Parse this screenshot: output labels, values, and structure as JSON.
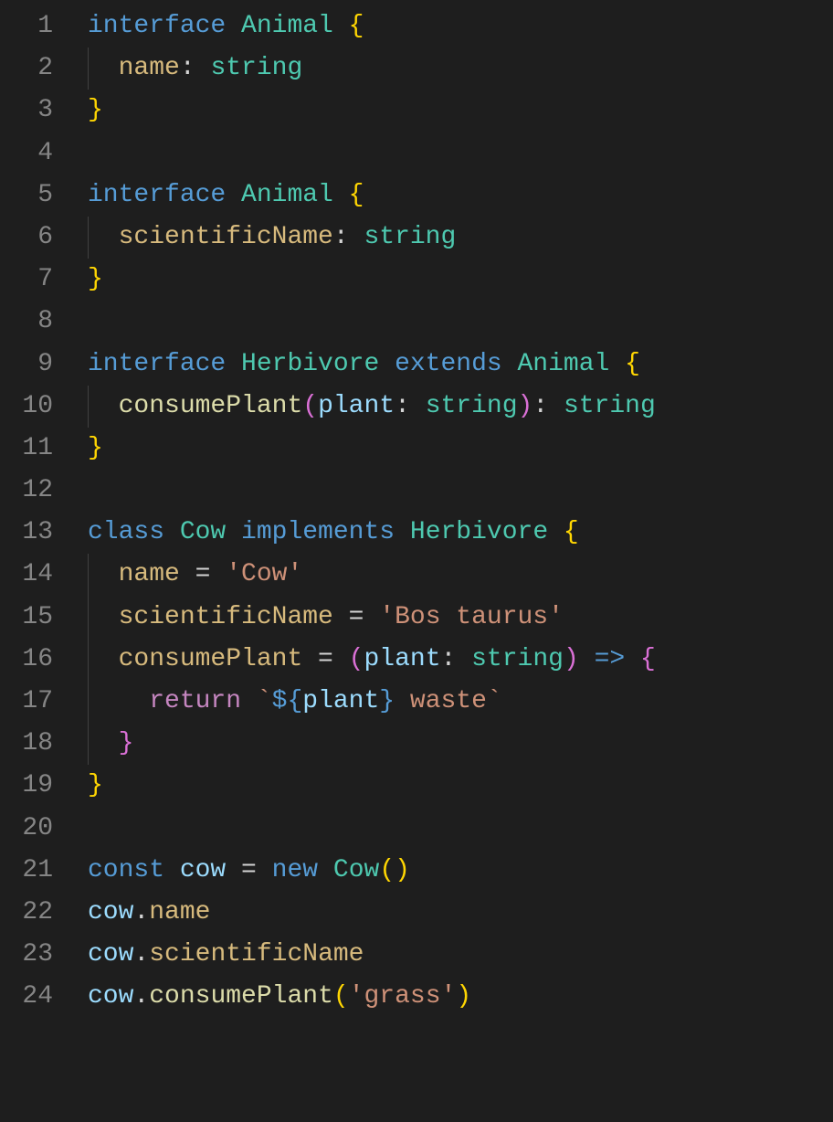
{
  "colors": {
    "background": "#1e1e1e",
    "gutter": "#858585",
    "keyword": "#569cd6",
    "type": "#4ec9b0",
    "property": "#d7ba7d",
    "variable": "#9cdcfe",
    "function": "#dcdcaa",
    "string": "#ce9178",
    "braceYellow": "#ffd602",
    "braceMagenta": "#da70d6",
    "control": "#c586c0"
  },
  "lineNumbers": [
    "1",
    "2",
    "3",
    "4",
    "5",
    "6",
    "7",
    "8",
    "9",
    "10",
    "11",
    "12",
    "13",
    "14",
    "15",
    "16",
    "17",
    "18",
    "19",
    "20",
    "21",
    "22",
    "23",
    "24"
  ],
  "code": {
    "lines": [
      {
        "indent": 0,
        "tokens": [
          {
            "t": "interface ",
            "c": "tok-storage"
          },
          {
            "t": "Animal ",
            "c": "tok-type"
          },
          {
            "t": "{",
            "c": "tok-brace"
          }
        ]
      },
      {
        "indent": 1,
        "guide": true,
        "tokens": [
          {
            "t": "name",
            "c": "tok-prop"
          },
          {
            "t": ": ",
            "c": "tok-punc"
          },
          {
            "t": "string",
            "c": "tok-typekw"
          }
        ]
      },
      {
        "indent": 0,
        "tokens": [
          {
            "t": "}",
            "c": "tok-brace"
          }
        ]
      },
      {
        "indent": 0,
        "tokens": []
      },
      {
        "indent": 0,
        "tokens": [
          {
            "t": "interface ",
            "c": "tok-storage"
          },
          {
            "t": "Animal ",
            "c": "tok-type"
          },
          {
            "t": "{",
            "c": "tok-brace"
          }
        ]
      },
      {
        "indent": 1,
        "guide": true,
        "tokens": [
          {
            "t": "scientificName",
            "c": "tok-prop"
          },
          {
            "t": ": ",
            "c": "tok-punc"
          },
          {
            "t": "string",
            "c": "tok-typekw"
          }
        ]
      },
      {
        "indent": 0,
        "tokens": [
          {
            "t": "}",
            "c": "tok-brace"
          }
        ]
      },
      {
        "indent": 0,
        "tokens": []
      },
      {
        "indent": 0,
        "tokens": [
          {
            "t": "interface ",
            "c": "tok-storage"
          },
          {
            "t": "Herbivore ",
            "c": "tok-type"
          },
          {
            "t": "extends ",
            "c": "tok-storage"
          },
          {
            "t": "Animal ",
            "c": "tok-type"
          },
          {
            "t": "{",
            "c": "tok-brace"
          }
        ]
      },
      {
        "indent": 1,
        "guide": true,
        "tokens": [
          {
            "t": "consumePlant",
            "c": "tok-func"
          },
          {
            "t": "(",
            "c": "tok-paren2"
          },
          {
            "t": "plant",
            "c": "tok-var"
          },
          {
            "t": ": ",
            "c": "tok-punc"
          },
          {
            "t": "string",
            "c": "tok-typekw"
          },
          {
            "t": ")",
            "c": "tok-paren2"
          },
          {
            "t": ": ",
            "c": "tok-punc"
          },
          {
            "t": "string",
            "c": "tok-typekw"
          }
        ]
      },
      {
        "indent": 0,
        "tokens": [
          {
            "t": "}",
            "c": "tok-brace"
          }
        ]
      },
      {
        "indent": 0,
        "tokens": []
      },
      {
        "indent": 0,
        "tokens": [
          {
            "t": "class ",
            "c": "tok-storage"
          },
          {
            "t": "Cow ",
            "c": "tok-type"
          },
          {
            "t": "implements ",
            "c": "tok-storage"
          },
          {
            "t": "Herbivore ",
            "c": "tok-type"
          },
          {
            "t": "{",
            "c": "tok-brace"
          }
        ]
      },
      {
        "indent": 1,
        "guide": true,
        "tokens": [
          {
            "t": "name",
            "c": "tok-prop"
          },
          {
            "t": " = ",
            "c": "tok-op"
          },
          {
            "t": "'Cow'",
            "c": "tok-string"
          }
        ]
      },
      {
        "indent": 1,
        "guide": true,
        "tokens": [
          {
            "t": "scientificName",
            "c": "tok-prop"
          },
          {
            "t": " = ",
            "c": "tok-op"
          },
          {
            "t": "'Bos taurus'",
            "c": "tok-string"
          }
        ]
      },
      {
        "indent": 1,
        "guide": true,
        "tokens": [
          {
            "t": "consumePlant",
            "c": "tok-prop"
          },
          {
            "t": " = ",
            "c": "tok-op"
          },
          {
            "t": "(",
            "c": "tok-paren2"
          },
          {
            "t": "plant",
            "c": "tok-var"
          },
          {
            "t": ": ",
            "c": "tok-punc"
          },
          {
            "t": "string",
            "c": "tok-typekw"
          },
          {
            "t": ")",
            "c": "tok-paren2"
          },
          {
            "t": " ",
            "c": "tok-op"
          },
          {
            "t": "=>",
            "c": "tok-arrow"
          },
          {
            "t": " ",
            "c": "tok-op"
          },
          {
            "t": "{",
            "c": "tok-brace2"
          }
        ]
      },
      {
        "indent": 2,
        "guide": true,
        "tokens": [
          {
            "t": "return ",
            "c": "tok-control"
          },
          {
            "t": "`",
            "c": "tok-string"
          },
          {
            "t": "${",
            "c": "tok-arrow"
          },
          {
            "t": "plant",
            "c": "tok-tmplv"
          },
          {
            "t": "}",
            "c": "tok-arrow"
          },
          {
            "t": " waste`",
            "c": "tok-string"
          }
        ]
      },
      {
        "indent": 1,
        "guide": true,
        "tokens": [
          {
            "t": "}",
            "c": "tok-brace2"
          }
        ]
      },
      {
        "indent": 0,
        "tokens": [
          {
            "t": "}",
            "c": "tok-brace"
          }
        ]
      },
      {
        "indent": 0,
        "tokens": []
      },
      {
        "indent": 0,
        "tokens": [
          {
            "t": "const ",
            "c": "tok-storage"
          },
          {
            "t": "cow",
            "c": "tok-var"
          },
          {
            "t": " = ",
            "c": "tok-op"
          },
          {
            "t": "new ",
            "c": "tok-storage"
          },
          {
            "t": "Cow",
            "c": "tok-type"
          },
          {
            "t": "()",
            "c": "tok-paren"
          }
        ]
      },
      {
        "indent": 0,
        "tokens": [
          {
            "t": "cow",
            "c": "tok-var"
          },
          {
            "t": ".",
            "c": "tok-punc"
          },
          {
            "t": "name",
            "c": "tok-prop"
          }
        ]
      },
      {
        "indent": 0,
        "tokens": [
          {
            "t": "cow",
            "c": "tok-var"
          },
          {
            "t": ".",
            "c": "tok-punc"
          },
          {
            "t": "scientificName",
            "c": "tok-prop"
          }
        ]
      },
      {
        "indent": 0,
        "tokens": [
          {
            "t": "cow",
            "c": "tok-var"
          },
          {
            "t": ".",
            "c": "tok-punc"
          },
          {
            "t": "consumePlant",
            "c": "tok-func"
          },
          {
            "t": "(",
            "c": "tok-paren"
          },
          {
            "t": "'grass'",
            "c": "tok-string"
          },
          {
            "t": ")",
            "c": "tok-paren"
          }
        ]
      }
    ]
  }
}
